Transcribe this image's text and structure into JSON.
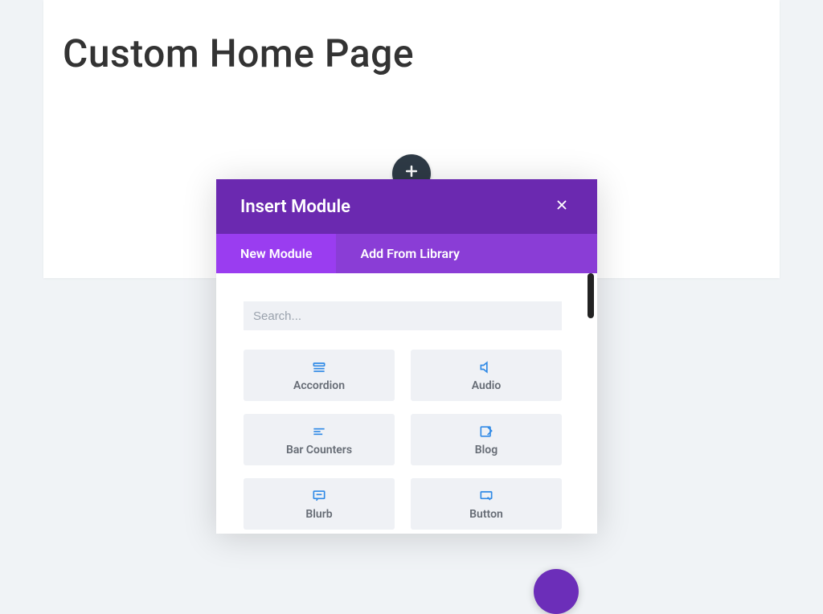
{
  "page": {
    "title": "Custom Home Page"
  },
  "modal": {
    "title": "Insert Module",
    "tabs": [
      {
        "label": "New Module",
        "active": true
      },
      {
        "label": "Add From Library",
        "active": false
      }
    ],
    "search_placeholder": "Search...",
    "modules": [
      {
        "label": "Accordion",
        "icon": "accordion-icon"
      },
      {
        "label": "Audio",
        "icon": "audio-icon"
      },
      {
        "label": "Bar Counters",
        "icon": "bar-counters-icon"
      },
      {
        "label": "Blog",
        "icon": "blog-icon"
      },
      {
        "label": "Blurb",
        "icon": "blurb-icon"
      },
      {
        "label": "Button",
        "icon": "button-icon"
      }
    ]
  }
}
